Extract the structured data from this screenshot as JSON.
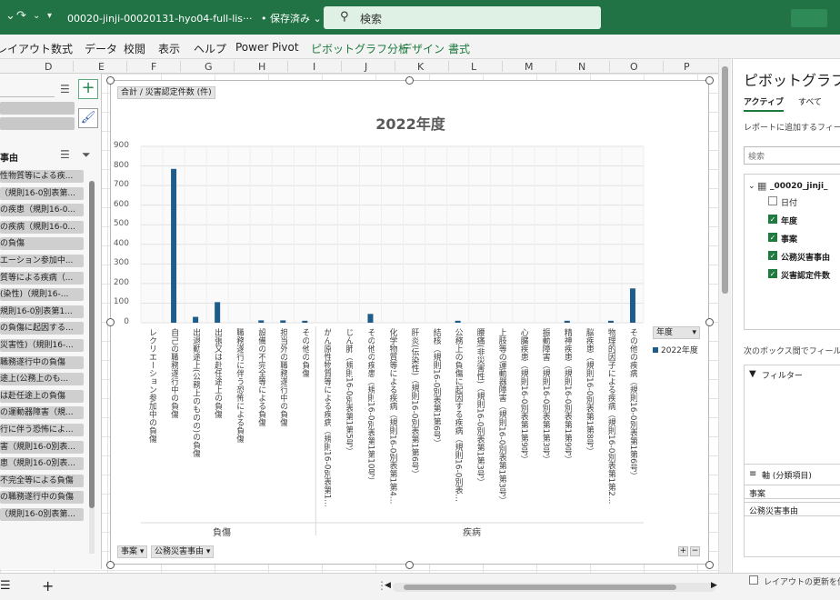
{
  "title_bar": {
    "file_name": "00020-jinji-00020131-hyo04-full-lis···",
    "save_status": "• 保存済み ⌄",
    "search_placeholder": "検索"
  },
  "ribbon_tabs": [
    "レイアウト",
    "数式",
    "データ",
    "校閲",
    "表示",
    "ヘルプ",
    "Power Pivot",
    "ピボットグラフ分析",
    "デザイン",
    "書式"
  ],
  "column_headers": [
    "D",
    "E",
    "F",
    "G",
    "H",
    "I",
    "J",
    "K",
    "L",
    "M",
    "N",
    "O",
    "P"
  ],
  "left_panel": {
    "slicer_title": "事由",
    "items": [
      "性物質等による疾...",
      "（規則16-0別表第...",
      "の疾患（規則16-0...",
      "の疾病（規則16-0...",
      "の負傷",
      "エーション参加中...",
      "質等による疾病（...",
      "(染性)（規則16-...",
      "規則16-0別表第1...",
      "の負傷に起因する...",
      "災害性)（規則16-...",
      "職務遂行中の負傷",
      "途上(公務上のも...",
      "は赴任途上の負傷",
      "の運動器障害（規...",
      "行に伴う恐怖によ...",
      "害（規則16-0別表...",
      "患（規則16-0別表...",
      "不完全等による負傷",
      "の職務遂行中の負傷",
      "（規則16-0別表第..."
    ]
  },
  "chart_data": {
    "type": "bar",
    "title": "2022年度",
    "value_field": "合計 / 災害認定件数 (件)",
    "axis_field_buttons": [
      "事案",
      "公務災害事由"
    ],
    "ylim": [
      0,
      900
    ],
    "yticks": [
      0,
      100,
      200,
      300,
      400,
      500,
      600,
      700,
      800,
      900
    ],
    "grid": true,
    "legend_title": "年度",
    "legend_position": "right",
    "series": [
      {
        "name": "2022年度",
        "color": "#1f5c8a"
      }
    ],
    "groups": [
      {
        "name": "負傷",
        "categories": [
          {
            "label": "レクリエーション参加中の負傷",
            "value": 0
          },
          {
            "label": "自己の職務遂行中の負傷",
            "value": 785
          },
          {
            "label": "出退勤途上(公務上のものの)の負傷",
            "value": 30
          },
          {
            "label": "出張又は赴任途上の負傷",
            "value": 105
          },
          {
            "label": "職務遂行に伴う恐怖による負傷",
            "value": 0
          },
          {
            "label": "設備の不完全等による負傷",
            "value": 12
          },
          {
            "label": "担当外の職務遂行中の負傷",
            "value": 12
          },
          {
            "label": "その他の負傷",
            "value": 10
          }
        ]
      },
      {
        "name": "疾病",
        "categories": [
          {
            "label": "がん原性物質等による疾病（規則16-0別表第1...",
            "value": 0
          },
          {
            "label": "じん肺（規則16-0別表第1第5号）",
            "value": 0
          },
          {
            "label": "その他の疾患（規則16-0別表第1第10号）",
            "value": 45
          },
          {
            "label": "化学物質等による疾病（規則16-0別表第1第4...",
            "value": 0
          },
          {
            "label": "肝炎(伝染性)（規則16-0別表第1第6号）",
            "value": 0
          },
          {
            "label": "結核（規則16-0別表第1第6号）",
            "value": 0
          },
          {
            "label": "公務上の負傷に起因する疾病（規則16-0別表...",
            "value": 10
          },
          {
            "label": "腰痛(非災害性)（規則16-0別表第1第3号）",
            "value": 0
          },
          {
            "label": "上肢等の運動器障害（規則16-0別表第1第3号）",
            "value": 0
          },
          {
            "label": "心臓疾患（規則16-0別表第1第9号）",
            "value": 0
          },
          {
            "label": "振動障害（規則16-0別表第1第3号）",
            "value": 0
          },
          {
            "label": "精神疾患（規則16-0別表第1第9号）",
            "value": 10
          },
          {
            "label": "脳疾患（規則16-0別表第1第8号）",
            "value": 0
          },
          {
            "label": "物理的因子による疾病（規則16-0別表第1第2...",
            "value": 10
          },
          {
            "label": "その他の疾病（規則16-0別表第1第6号）",
            "value": 175
          }
        ]
      }
    ]
  },
  "right_panel": {
    "title": "ピボットグラフの",
    "tab_active": "アクティブ",
    "tab_all": "すべて",
    "add_field_text": "レポートに追加するフィールド",
    "search_placeholder": "検索",
    "table_name": "_00020_jinji_",
    "fields": [
      {
        "name": "日付",
        "checked": false
      },
      {
        "name": "年度",
        "checked": true
      },
      {
        "name": "事案",
        "checked": true
      },
      {
        "name": "公務災害事由",
        "checked": true
      },
      {
        "name": "災害認定件数",
        "checked": true
      }
    ],
    "drag_hint": "次のボックス間でフィールドを",
    "filter_label": "フィルター",
    "axis_label": "軸 (分類項目)",
    "axis_items": [
      "事案",
      "公務災害事由"
    ],
    "defer_label": "レイアウトの更新を保"
  }
}
